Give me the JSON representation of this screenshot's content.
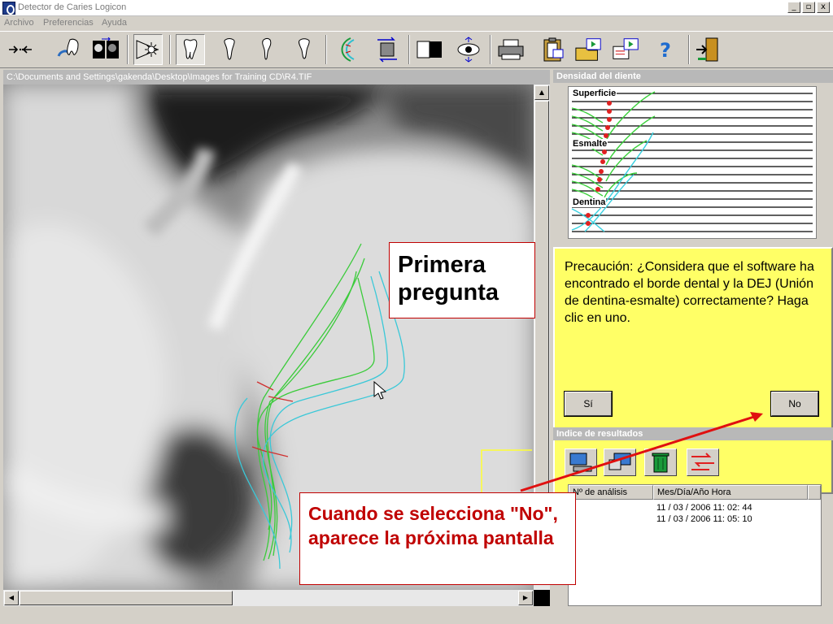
{
  "window": {
    "title": "Detector de Caries Logicon",
    "controls": [
      "_",
      "▫",
      "x"
    ]
  },
  "menu": [
    "Archivo",
    "Preferencias",
    "Ayuda"
  ],
  "toolbar": {
    "icons": [
      "move-icon",
      "tooth-detect-icon",
      "compare-images-icon",
      "light-icon",
      "tooth-1-icon",
      "tooth-2-icon",
      "tooth-3-icon",
      "tooth-4-icon",
      "contour-icon",
      "reverse-icon",
      "contrast-icon",
      "view-icon",
      "print-icon",
      "clipboard-icon",
      "export-icon",
      "report-icon",
      "help-icon",
      "exit-icon"
    ]
  },
  "image_panel": {
    "path": "C:\\Documents and Settings\\gakenda\\Desktop\\Images for Training CD\\R4.TIF"
  },
  "density_panel": {
    "title": "Densidad del diente",
    "labels": [
      "Superficie",
      "Esmalte",
      "Dentina"
    ]
  },
  "caution": {
    "message": "Precaución: ¿Considera que el software ha encontrado el borde dental y la DEJ (Unión de dentina-esmalte) correctamente? Haga clic en uno.",
    "yes_label": "Sí",
    "no_label": "No",
    "bg_color": "#ffff66"
  },
  "results": {
    "title": "Indice de resultados",
    "columns": [
      "Nº de análisis",
      "Mes/Día/Año  Hora"
    ],
    "rows": [
      "11 / 03 / 2006   11: 02: 44",
      "11 / 03 / 2006   11: 05: 10"
    ]
  },
  "callouts": {
    "first": "Primera pregunta",
    "second": "Cuando se selecciona \"No\", aparece la próxima pantalla"
  }
}
